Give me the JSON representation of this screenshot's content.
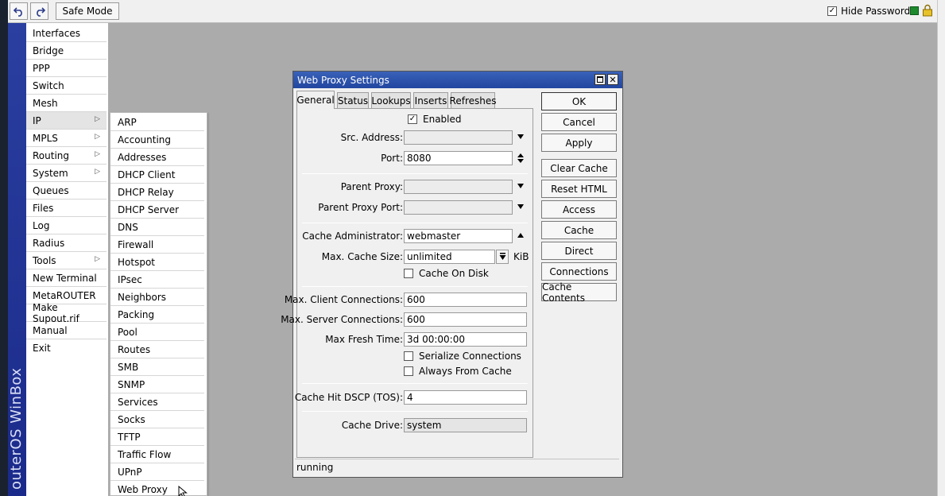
{
  "toolbar": {
    "undo_icon": "undo-icon",
    "redo_icon": "redo-icon",
    "safe_mode_label": "Safe Mode",
    "hide_passwords_label": "Hide Passwords",
    "hide_passwords_checked": "✓",
    "status_color": "#1d8a2d"
  },
  "brand": {
    "vertical_text": "outerOS WinBox"
  },
  "main_menu": {
    "items": [
      {
        "label": "Interfaces"
      },
      {
        "label": "Bridge"
      },
      {
        "label": "PPP"
      },
      {
        "label": "Switch"
      },
      {
        "label": "Mesh"
      },
      {
        "label": "IP"
      },
      {
        "label": "MPLS"
      },
      {
        "label": "Routing"
      },
      {
        "label": "System"
      },
      {
        "label": "Queues"
      },
      {
        "label": "Files"
      },
      {
        "label": "Log"
      },
      {
        "label": "Radius"
      },
      {
        "label": "Tools"
      },
      {
        "label": "New Terminal"
      },
      {
        "label": "MetaROUTER"
      },
      {
        "label": "Make Supout.rif"
      },
      {
        "label": "Manual"
      },
      {
        "label": "Exit"
      }
    ]
  },
  "ip_submenu": {
    "items": [
      {
        "label": "ARP"
      },
      {
        "label": "Accounting"
      },
      {
        "label": "Addresses"
      },
      {
        "label": "DHCP Client"
      },
      {
        "label": "DHCP Relay"
      },
      {
        "label": "DHCP Server"
      },
      {
        "label": "DNS"
      },
      {
        "label": "Firewall"
      },
      {
        "label": "Hotspot"
      },
      {
        "label": "IPsec"
      },
      {
        "label": "Neighbors"
      },
      {
        "label": "Packing"
      },
      {
        "label": "Pool"
      },
      {
        "label": "Routes"
      },
      {
        "label": "SMB"
      },
      {
        "label": "SNMP"
      },
      {
        "label": "Services"
      },
      {
        "label": "Socks"
      },
      {
        "label": "TFTP"
      },
      {
        "label": "Traffic Flow"
      },
      {
        "label": "UPnP"
      },
      {
        "label": "Web Proxy"
      }
    ]
  },
  "dialog": {
    "title": "Web Proxy Settings",
    "tabs": [
      {
        "label": "General"
      },
      {
        "label": "Status"
      },
      {
        "label": "Lookups"
      },
      {
        "label": "Inserts"
      },
      {
        "label": "Refreshes"
      }
    ],
    "general": {
      "enabled_label": "Enabled",
      "enabled_mark": "✓",
      "src_address_label": "Src. Address:",
      "src_address_value": "",
      "port_label": "Port:",
      "port_value": "8080",
      "parent_proxy_label": "Parent Proxy:",
      "parent_proxy_value": "",
      "parent_proxy_port_label": "Parent Proxy Port:",
      "parent_proxy_port_value": "",
      "cache_admin_label": "Cache Administrator:",
      "cache_admin_value": "webmaster",
      "max_cache_size_label": "Max. Cache Size:",
      "max_cache_size_value": "unlimited",
      "max_cache_size_unit": "KiB",
      "cache_on_disk_label": "Cache On Disk",
      "max_client_conn_label": "Max. Client Connections:",
      "max_client_conn_value": "600",
      "max_server_conn_label": "Max. Server Connections:",
      "max_server_conn_value": "600",
      "max_fresh_time_label": "Max Fresh Time:",
      "max_fresh_time_value": "3d 00:00:00",
      "serialize_conn_label": "Serialize Connections",
      "always_from_cache_label": "Always From Cache",
      "cache_hit_dscp_label": "Cache Hit DSCP (TOS):",
      "cache_hit_dscp_value": "4",
      "cache_drive_label": "Cache Drive:",
      "cache_drive_value": "system"
    },
    "buttons": {
      "ok": "OK",
      "cancel": "Cancel",
      "apply": "Apply",
      "clear_cache": "Clear Cache",
      "reset_html": "Reset HTML",
      "access": "Access",
      "cache": "Cache",
      "direct": "Direct",
      "connections": "Connections",
      "cache_contents": "Cache Contents"
    },
    "status_text": "running"
  }
}
